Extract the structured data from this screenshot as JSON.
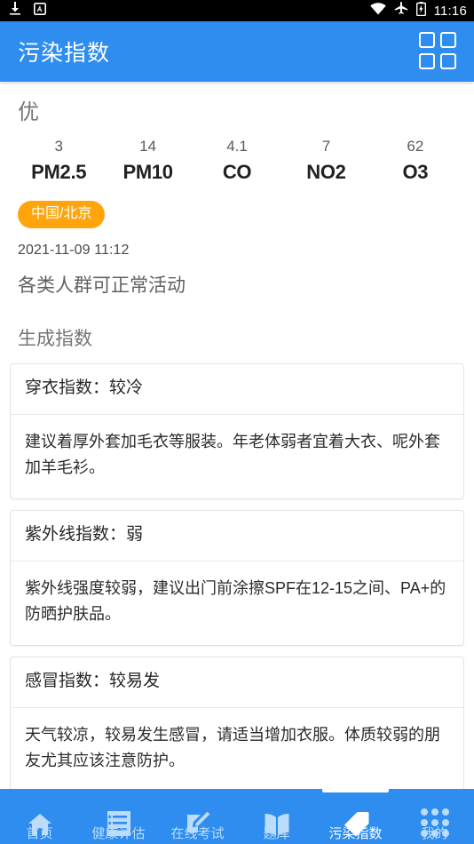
{
  "status_bar": {
    "icons_left": [
      "download-icon",
      "keyboard-input-icon"
    ],
    "icons_right": [
      "wifi-icon",
      "airplane-mode-icon",
      "battery-charging-icon"
    ],
    "time": "11:16"
  },
  "app_bar": {
    "title": "污染指数",
    "action_icon": "grid-menu-icon"
  },
  "air_quality": {
    "level": "优",
    "pollutants": [
      {
        "value": "3",
        "name": "PM2.5"
      },
      {
        "value": "14",
        "name": "PM10"
      },
      {
        "value": "4.1",
        "name": "CO"
      },
      {
        "value": "7",
        "name": "NO2"
      },
      {
        "value": "62",
        "name": "O3"
      }
    ],
    "location_badge": "中国/北京",
    "badge_color": "#FFA40B",
    "timestamp": "2021-11-09 11:12",
    "advice": "各类人群可正常活动"
  },
  "indices_section": {
    "title": "生成指数",
    "cards": [
      {
        "title": "穿衣指数：较冷",
        "body": "建议着厚外套加毛衣等服装。年老体弱者宜着大衣、呢外套加羊毛衫。"
      },
      {
        "title": "紫外线指数：弱",
        "body": "紫外线强度较弱，建议出门前涂擦SPF在12-15之间、PA+的防晒护肤品。"
      },
      {
        "title": "感冒指数：较易发",
        "body": "天气较凉，较易发生感冒，请适当增加衣服。体质较弱的朋友尤其应该注意防护。"
      }
    ]
  },
  "bottom_nav": {
    "accent_color": "#2E8DEE",
    "items": [
      {
        "label": "首页",
        "icon": "home-icon",
        "active": false
      },
      {
        "label": "健康评估",
        "icon": "checklist-icon",
        "active": false
      },
      {
        "label": "在线考试",
        "icon": "edit-paper-icon",
        "active": false
      },
      {
        "label": "题库",
        "icon": "book-icon",
        "active": false
      },
      {
        "label": "污染指数",
        "icon": "tag-icon",
        "active": true
      },
      {
        "label": "我的",
        "icon": "grid-dots-icon",
        "active": false
      }
    ]
  }
}
